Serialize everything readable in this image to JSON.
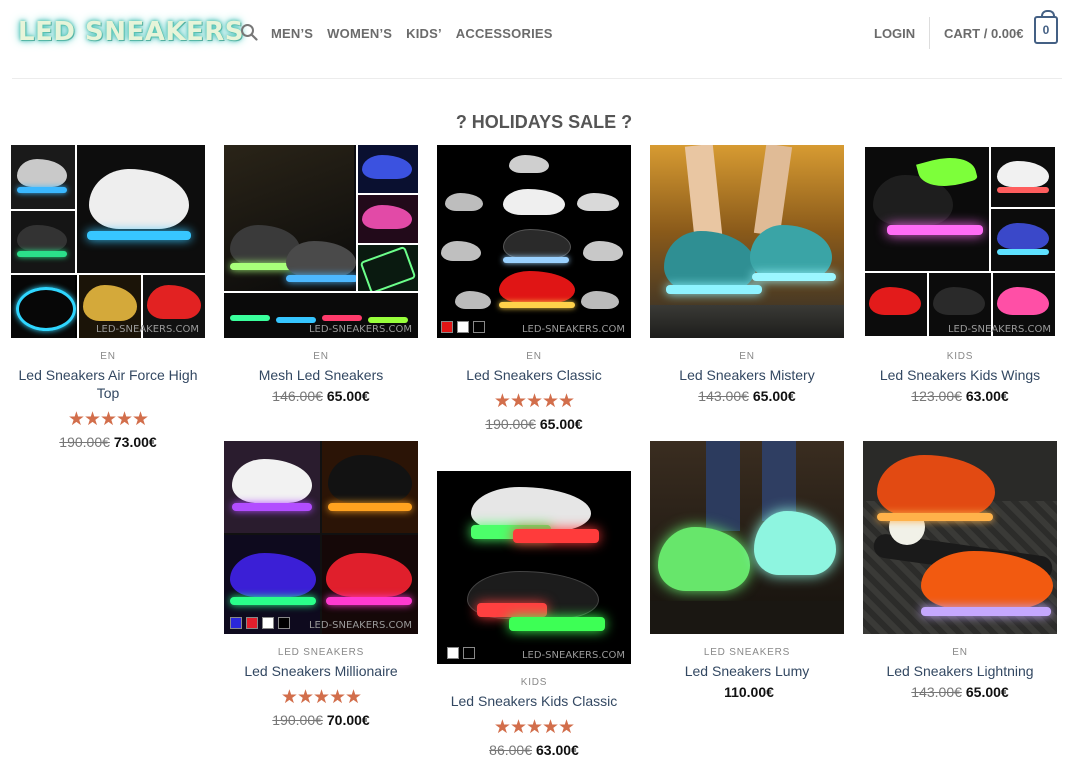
{
  "header": {
    "logo": "LED SNEAKERS",
    "nav": [
      "MEN’S",
      "WOMEN’S",
      "KIDS’",
      "ACCESSORIES"
    ],
    "login": "LOGIN",
    "cart_label": "CART / 0.00€",
    "cart_count": "0"
  },
  "section_title": "? HOLIDAYS SALE ?",
  "products": [
    {
      "category": "EN",
      "name": "Led Sneakers Air Force High Top",
      "stars": "★★★★★",
      "old_price": "190.00€",
      "price": "73.00€",
      "watermark": "LED-SNEAKERS.COM"
    },
    {
      "category": "EN",
      "name": "Mesh Led Sneakers",
      "stars": "",
      "old_price": "146.00€",
      "price": "65.00€",
      "watermark": "LED-SNEAKERS.COM"
    },
    {
      "category": "EN",
      "name": "Led Sneakers Classic",
      "stars": "★★★★★",
      "old_price": "190.00€",
      "price": "65.00€",
      "watermark": "LED-SNEAKERS.COM"
    },
    {
      "category": "EN",
      "name": "Led Sneakers Mistery",
      "stars": "",
      "old_price": "143.00€",
      "price": "65.00€",
      "watermark": ""
    },
    {
      "category": "KIDS",
      "name": "Led Sneakers Kids Wings",
      "stars": "",
      "old_price": "123.00€",
      "price": "63.00€",
      "watermark": "LED-SNEAKERS.COM"
    },
    {
      "category": "LED SNEAKERS",
      "name": "Led Sneakers Millionaire",
      "stars": "★★★★★",
      "old_price": "190.00€",
      "price": "70.00€",
      "watermark": "LED-SNEAKERS.COM"
    },
    {
      "category": "KIDS",
      "name": "Led Sneakers Kids Classic",
      "stars": "★★★★★",
      "old_price": "86.00€",
      "price": "63.00€",
      "watermark": "LED-SNEAKERS.COM"
    },
    {
      "category": "LED SNEAKERS",
      "name": "Led Sneakers Lumy",
      "stars": "",
      "old_price": "",
      "price": "110.00€",
      "watermark": ""
    },
    {
      "category": "EN",
      "name": "Led Sneakers Lightning",
      "stars": "",
      "old_price": "143.00€",
      "price": "65.00€",
      "watermark": ""
    }
  ],
  "colors": {
    "accent": "#446084",
    "stars": "#d26e4b",
    "link": "#334862"
  }
}
